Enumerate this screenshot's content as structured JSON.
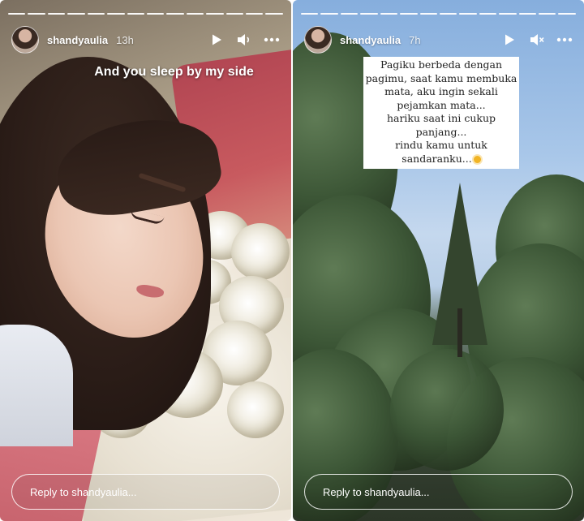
{
  "stories": [
    {
      "username": "shandyaulia",
      "time": "13h",
      "caption": "And you sleep by my side",
      "reply_placeholder": "Reply to shandyaulia...",
      "progress": {
        "segments": 14,
        "current": 14
      },
      "controls": {
        "play_icon": "play-icon",
        "audio_icon": "volume-icon",
        "more_icon": "more-icon"
      }
    },
    {
      "username": "shandyaulia",
      "time": "7h",
      "note_lines": [
        "Pagiku berbeda dengan",
        "pagimu, saat kamu membuka",
        "mata, aku ingin sekali",
        "pejamkan mata...",
        "hariku saat ini cukup",
        "panjang...",
        "rindu kamu untuk",
        "sandaranku..."
      ],
      "note_emoji": "sun-emoji",
      "reply_placeholder": "Reply to shandyaulia...",
      "progress": {
        "segments": 14,
        "current": 14
      },
      "controls": {
        "play_icon": "play-icon",
        "audio_icon": "muted-icon",
        "more_icon": "more-icon"
      }
    }
  ],
  "colors": {
    "text": "#ffffff",
    "note_bg": "#ffffff",
    "sun": "#f1b425"
  }
}
